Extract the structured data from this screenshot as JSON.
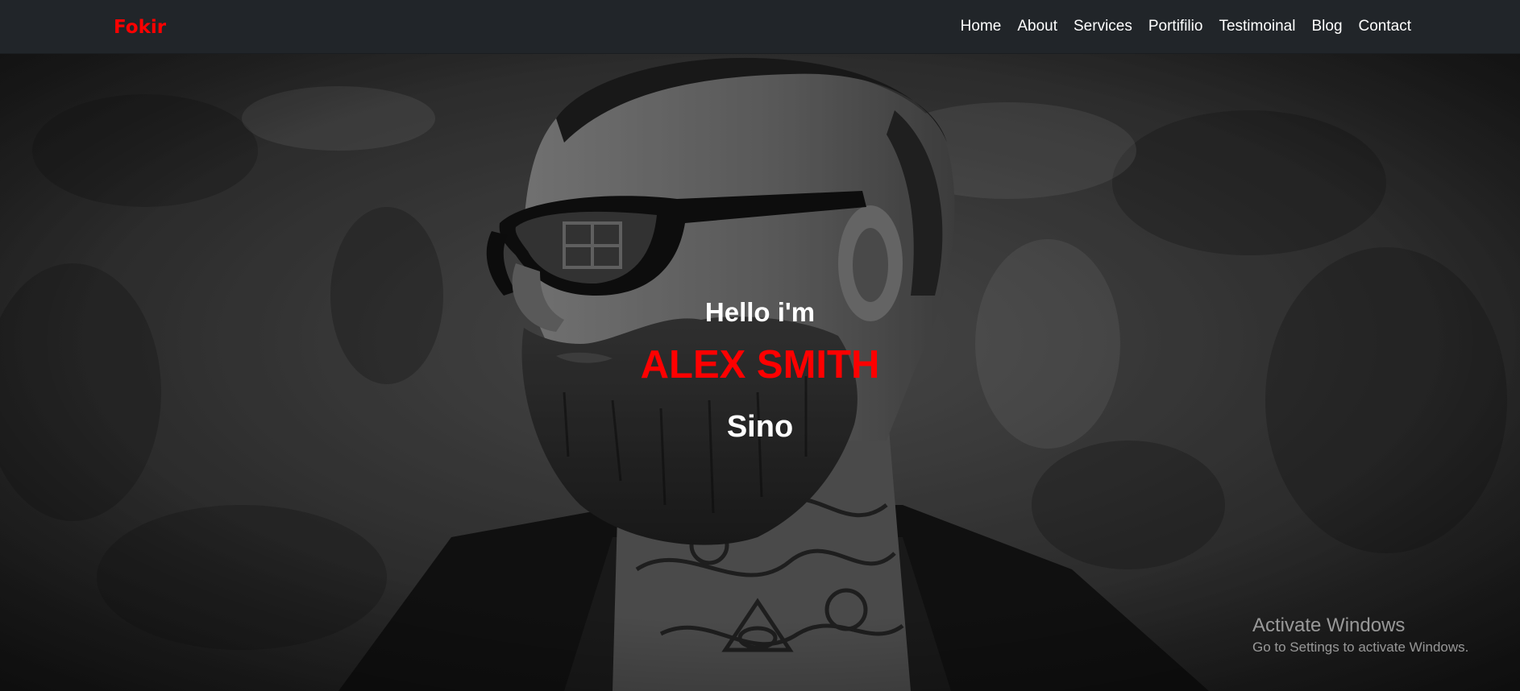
{
  "navbar": {
    "brand": "Fokir",
    "links": [
      "Home",
      "About",
      "Services",
      "Portifilio",
      "Testimoinal",
      "Blog",
      "Contact"
    ]
  },
  "hero": {
    "greeting": "Hello i'm",
    "name": "ALEX SMITH",
    "role": "Sino",
    "image_description": "grayscale portrait of a bearded man wearing sunglasses with neck tattoos against a textured dark wall"
  },
  "watermark": {
    "title": "Activate Windows",
    "subtitle": "Go to Settings to activate Windows."
  },
  "colors": {
    "navbar_bg": "#212529",
    "brand": "#ff0000",
    "accent_name": "#ff0000",
    "text": "#ffffff"
  }
}
